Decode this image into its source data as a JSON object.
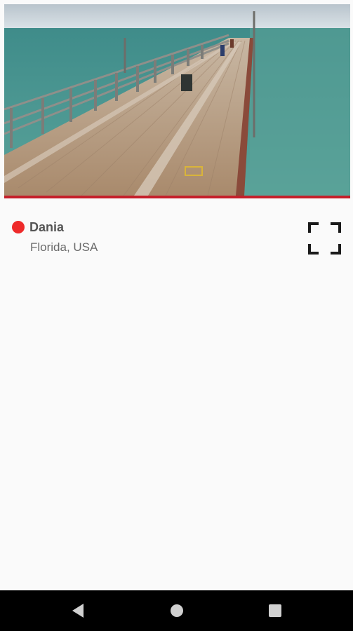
{
  "camera": {
    "name": "Dania",
    "location": "Florida, USA",
    "live_color": "#ee2a2a"
  },
  "icons": {
    "fullscreen": "fullscreen-icon",
    "back": "back-triangle-icon",
    "home": "home-circle-icon",
    "recents": "recents-square-icon"
  },
  "colors": {
    "accent_rule": "#c51f2a",
    "background": "#fafafa",
    "navbar": "#000000"
  }
}
